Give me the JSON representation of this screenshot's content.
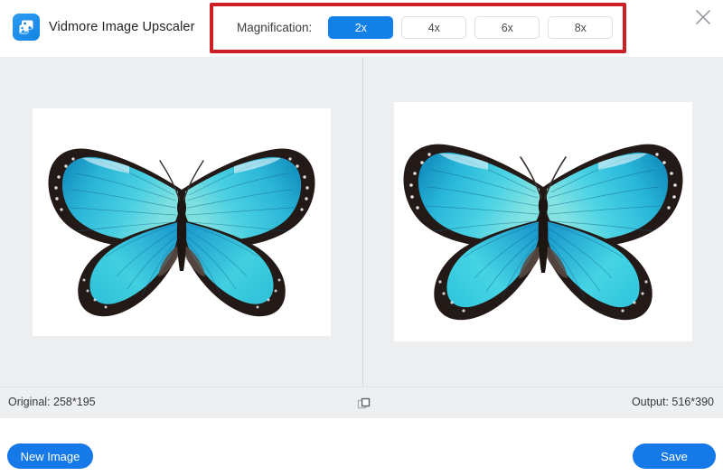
{
  "app": {
    "title": "Vidmore Image Upscaler",
    "logo_icon": "image-upscaler-logo-icon",
    "accent_color": "#1280e6",
    "annotation_color": "#cc2026",
    "content_bg": "#edeef0"
  },
  "header": {
    "close_icon": "close-icon",
    "magnification": {
      "label": "Magnification:",
      "selected": "2x",
      "options": [
        {
          "label": "2x",
          "selected": true
        },
        {
          "label": "4x",
          "selected": false
        },
        {
          "label": "6x",
          "selected": false
        },
        {
          "label": "8x",
          "selected": false
        }
      ]
    }
  },
  "main": {
    "left_pane": {
      "name": "original-preview",
      "image_subject": "blue-morpho-butterfly"
    },
    "right_pane": {
      "name": "upscaled-preview",
      "image_subject": "blue-morpho-butterfly"
    }
  },
  "status_bar": {
    "original": "Original: 258*195",
    "output": "Output: 516*390",
    "compare_icon": "overlapping-squares-icon"
  },
  "footer": {
    "new_image_label": "New Image",
    "save_label": "Save"
  }
}
